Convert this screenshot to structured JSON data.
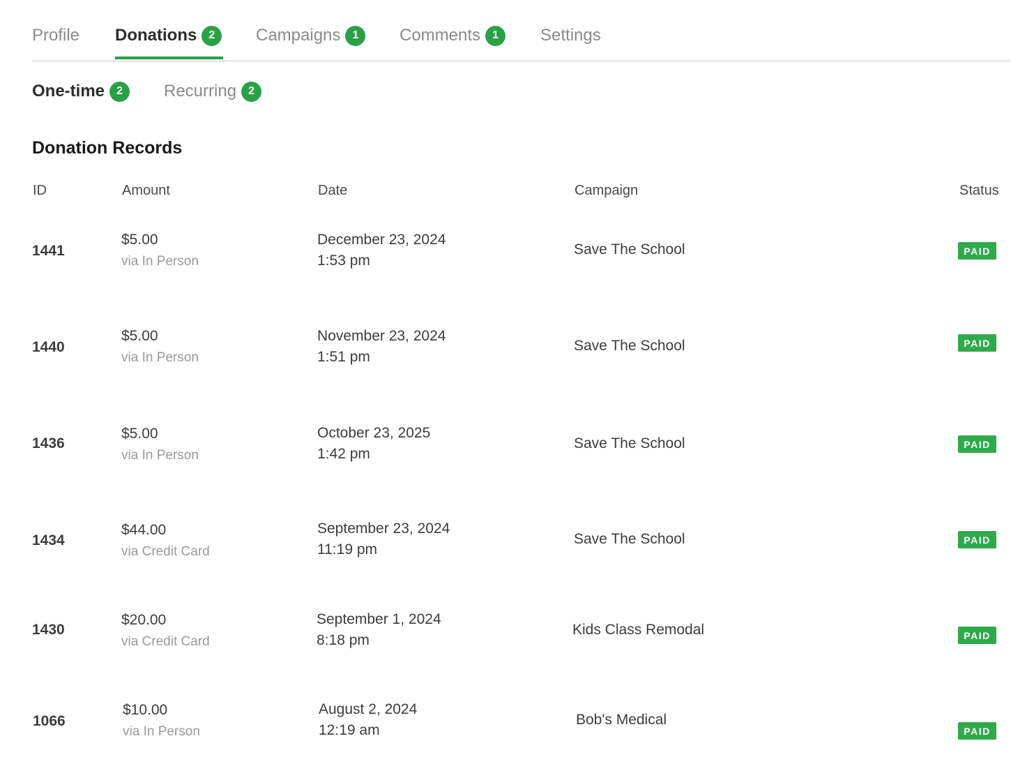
{
  "tabs": [
    {
      "label": "Profile",
      "count": ""
    },
    {
      "label": "Donations",
      "count": "2"
    },
    {
      "label": "Campaigns",
      "count": "1"
    },
    {
      "label": "Comments",
      "count": "1"
    },
    {
      "label": "Settings",
      "count": ""
    }
  ],
  "subtabs": [
    {
      "label": "One-time",
      "count": "2"
    },
    {
      "label": "Recurring",
      "count": "2"
    }
  ],
  "section_title": "Donation Records",
  "columns": {
    "id": "ID",
    "amount": "Amount",
    "date": "Date",
    "campaign": "Campaign",
    "status": "Status"
  },
  "rows": [
    {
      "id": "1441",
      "amount": "$5.00",
      "method": "via In Person",
      "date": "December 23, 2024",
      "time": "1:53 pm",
      "campaign": "Save The School",
      "status": "PAID"
    },
    {
      "id": "1440",
      "amount": "$5.00",
      "method": "via In Person",
      "date": "November 23, 2024",
      "time": "1:51 pm",
      "campaign": "Save The School",
      "status": "PAID"
    },
    {
      "id": "1436",
      "amount": "$5.00",
      "method": "via In Person",
      "date": "October 23, 2025",
      "time": "1:42 pm",
      "campaign": "Save The School",
      "status": "PAID"
    },
    {
      "id": "1434",
      "amount": "$44.00",
      "method": "via Credit Card",
      "date": "September 23, 2024",
      "time": "11:19 pm",
      "campaign": "Save The School",
      "status": "PAID"
    },
    {
      "id": "1430",
      "amount": "$20.00",
      "method": "via Credit Card",
      "date": "September 1, 2024",
      "time": "8:18 pm",
      "campaign": "Kids Class Remodal",
      "status": "PAID"
    },
    {
      "id": "1066",
      "amount": "$10.00",
      "method": "via In Person",
      "date": "August 2, 2024",
      "time": "12:19 am",
      "campaign": "Bob's Medical",
      "status": "PAID"
    }
  ],
  "colors": {
    "accent": "#2aa146",
    "badge": "#2faa4a"
  }
}
